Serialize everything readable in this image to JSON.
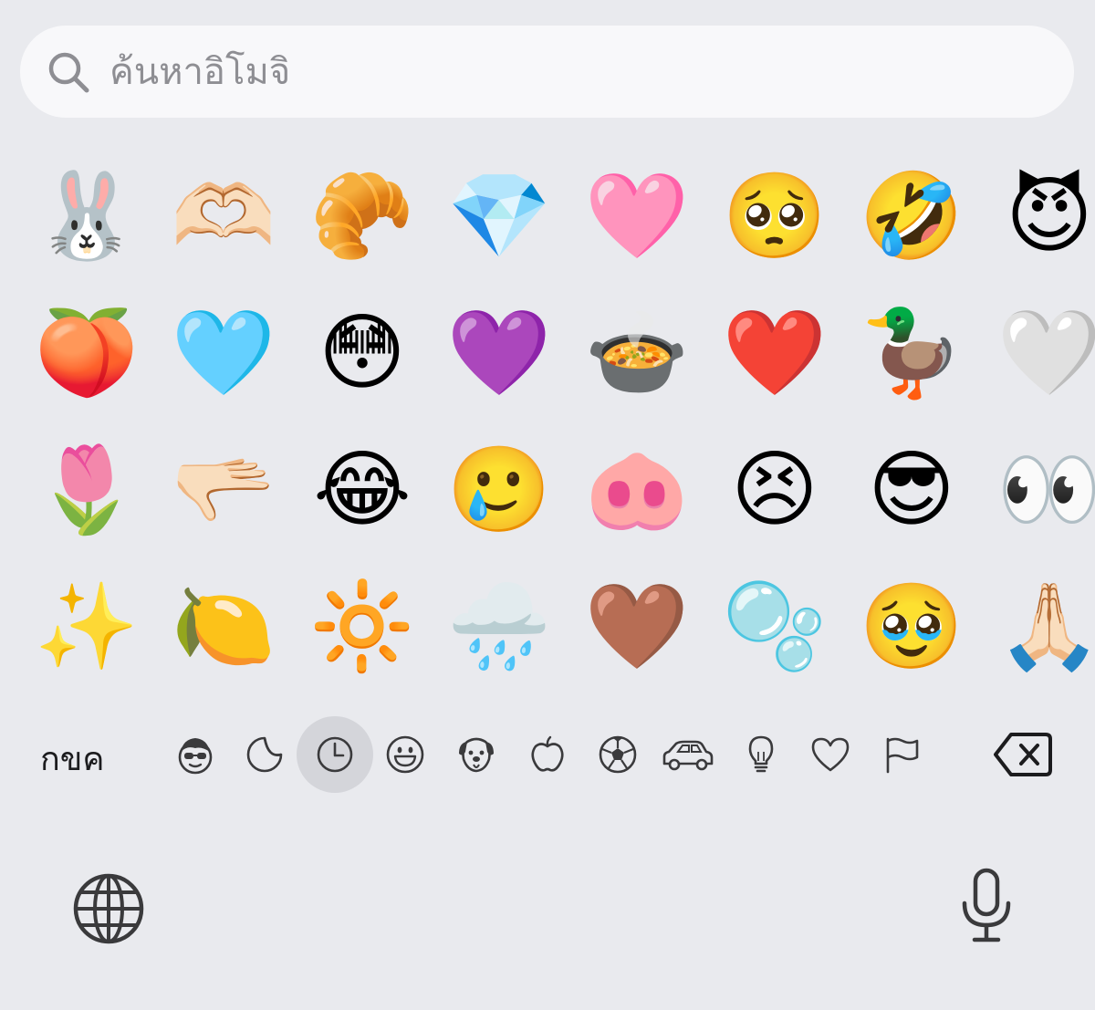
{
  "search": {
    "placeholder": "ค้นหาอิโมจิ"
  },
  "emoji_rows": [
    [
      "🐰",
      "🫶🏻",
      "🥐",
      "💎",
      "🩷",
      "🥺",
      "🤣",
      "😈"
    ],
    [
      "🍑",
      "🩵",
      "😳",
      "💜",
      "🍲",
      "❤️",
      "🦆",
      "🤍"
    ],
    [
      "🌷",
      "🫳🏻",
      "😂",
      "🥲",
      "🐽",
      "😣",
      "😎",
      "👀"
    ],
    [
      "✨",
      "🍋",
      "🔆",
      "🌧️",
      "🤎",
      "🫧",
      "🥹",
      "🙏🏻"
    ]
  ],
  "category_bar": {
    "abc_label": "กขค",
    "categories": [
      {
        "icon": "memoji-icon"
      },
      {
        "icon": "sticker-icon"
      },
      {
        "icon": "recent-clock-icon",
        "active": true
      },
      {
        "icon": "smiley-icon"
      },
      {
        "icon": "dog-icon"
      },
      {
        "icon": "apple-icon"
      },
      {
        "icon": "soccer-ball-icon"
      },
      {
        "icon": "car-icon"
      },
      {
        "icon": "lightbulb-icon"
      },
      {
        "icon": "heart-icon"
      },
      {
        "icon": "flag-icon"
      }
    ]
  },
  "colors": {
    "background": "#e9eaee",
    "search_background": "#f8f8fa",
    "icon": "#3a3a3c",
    "active_category": "#d4d5da"
  }
}
